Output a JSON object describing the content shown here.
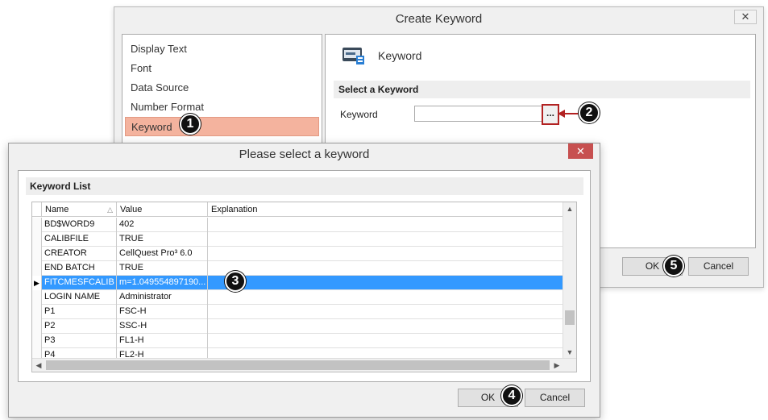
{
  "create_dialog": {
    "title": "Create Keyword",
    "close_glyph": "✕",
    "categories": [
      {
        "label": "Display Text"
      },
      {
        "label": "Font"
      },
      {
        "label": "Data Source"
      },
      {
        "label": "Number Format"
      },
      {
        "label": "Keyword",
        "selected": true
      }
    ],
    "heading": "Keyword",
    "section_title": "Select a Keyword",
    "field_label": "Keyword",
    "field_value": "",
    "browse_label": "...",
    "ok_label": "OK",
    "cancel_label": "Cancel"
  },
  "select_dialog": {
    "title": "Please select a keyword",
    "close_glyph": "✕",
    "section_title": "Keyword List",
    "columns": [
      "Name",
      "Value",
      "Explanation"
    ],
    "sort_indicator": "△",
    "rows": [
      {
        "name": "BD$WORD9",
        "value": "402",
        "explanation": ""
      },
      {
        "name": "CALIBFILE",
        "value": "TRUE",
        "explanation": ""
      },
      {
        "name": "CREATOR",
        "value": "CellQuest Pro³ 6.0",
        "explanation": ""
      },
      {
        "name": "END BATCH",
        "value": "TRUE",
        "explanation": ""
      },
      {
        "name": "FITCMESFCALIB",
        "value": "m=1.049554897190...",
        "explanation": "",
        "selected": true
      },
      {
        "name": "LOGIN NAME",
        "value": "Administrator",
        "explanation": ""
      },
      {
        "name": "P1",
        "value": "FSC-H",
        "explanation": ""
      },
      {
        "name": "P2",
        "value": "SSC-H",
        "explanation": ""
      },
      {
        "name": "P3",
        "value": "FL1-H",
        "explanation": ""
      },
      {
        "name": "P4",
        "value": "FL2-H",
        "explanation": ""
      }
    ],
    "ok_label": "OK",
    "cancel_label": "Cancel"
  },
  "callouts": [
    "1",
    "2",
    "3",
    "4",
    "5"
  ],
  "colors": {
    "selection_row": "#3399ff",
    "category_highlight": "#f4b39e",
    "callout_arrow": "#b22222",
    "close_button": "#c75050"
  }
}
